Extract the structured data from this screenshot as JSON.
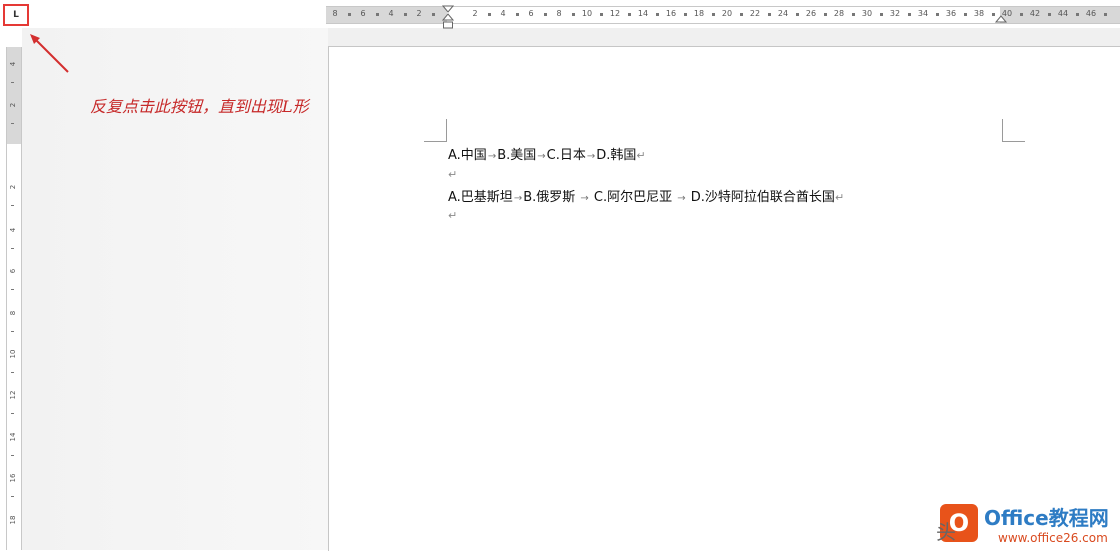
{
  "tab_selector": {
    "label": "L"
  },
  "ruler": {
    "horizontal_numbers": [
      "8",
      "6",
      "4",
      "2",
      "2",
      "4",
      "6",
      "8",
      "10",
      "12",
      "14",
      "16",
      "18",
      "20",
      "22",
      "24",
      "26",
      "28",
      "30",
      "32",
      "34",
      "36",
      "38",
      "40",
      "42",
      "44",
      "46"
    ],
    "vertical_numbers": [
      "4",
      "2",
      "2",
      "4",
      "6",
      "8",
      "10",
      "12",
      "14",
      "16",
      "18"
    ]
  },
  "annotation": {
    "text": "反复点击此按钮，直到出现L形"
  },
  "document": {
    "line1": [
      {
        "text": "A.中国"
      },
      {
        "tab": true
      },
      {
        "text": "B.美国"
      },
      {
        "tab": true
      },
      {
        "text": "C.日本"
      },
      {
        "tab": true
      },
      {
        "text": "D.韩国"
      }
    ],
    "line2": [
      {
        "text": "A.巴基斯坦"
      },
      {
        "tab": true
      },
      {
        "text": "B.俄罗斯 "
      },
      {
        "tab": true
      },
      {
        "text": " C.阿尔巴尼亚 "
      },
      {
        "tab": true
      },
      {
        "text": " D.沙特阿拉伯联合酋长国"
      }
    ],
    "tab_glyph": "→",
    "paragraph_mark": "↵"
  },
  "watermark": {
    "logo_letter": "O",
    "brand": "Office教程网",
    "url": "www.office26.com",
    "prefix": "头"
  }
}
